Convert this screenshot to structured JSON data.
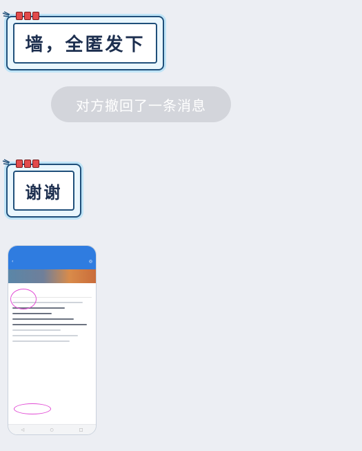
{
  "messages": [
    {
      "text": "墙，全匿发下"
    },
    {
      "text": "谢谢"
    }
  ],
  "system_notice": "对方撤回了一条消息",
  "colors": {
    "bubble_border": "#1f4f7a",
    "bubble_fill": "#e9f6fd",
    "notice_bg": "#d3d5db",
    "phone_header": "#2f7ce0"
  },
  "icons": {
    "hand": "pointing-hand-icon",
    "tag": "red-tag-icon"
  }
}
